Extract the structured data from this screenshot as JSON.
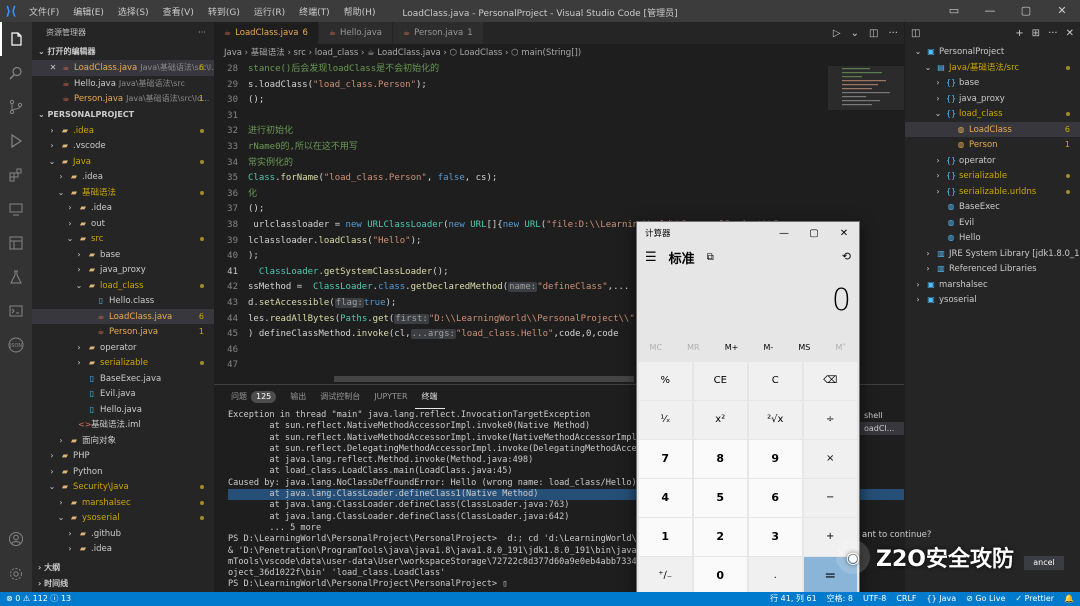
{
  "window": {
    "title": "LoadClass.java - PersonalProject - Visual Studio Code [管理员]",
    "menu": [
      "文件(F)",
      "编辑(E)",
      "选择(S)",
      "查看(V)",
      "转到(G)",
      "运行(R)",
      "终端(T)",
      "帮助(H)"
    ]
  },
  "sidebar": {
    "title": "资源管理器",
    "open_editors_header": "打开的编辑器",
    "open_editors": [
      {
        "name": "LoadClass.java",
        "desc": "Java\\基础语法\\src\\l...",
        "badge": "6"
      },
      {
        "name": "Hello.java",
        "desc": "Java\\基础语法\\src",
        "badge": ""
      },
      {
        "name": "Person.java",
        "desc": "Java\\基础语法\\src\\lo...",
        "badge": "1"
      }
    ],
    "project_header": "PERSONALPROJECT",
    "tree": [
      {
        "label": ".idea",
        "indent": 1,
        "type": "folder",
        "arrow": "›",
        "dot": true
      },
      {
        "label": ".vscode",
        "indent": 1,
        "type": "folder",
        "arrow": "›",
        "dot": false
      },
      {
        "label": "Java",
        "indent": 1,
        "type": "folder",
        "arrow": "⌄",
        "dot": true
      },
      {
        "label": ".idea",
        "indent": 2,
        "type": "folder",
        "arrow": "›",
        "dot": false
      },
      {
        "label": "基础语法",
        "indent": 2,
        "type": "folder",
        "arrow": "⌄",
        "dot": true
      },
      {
        "label": ".idea",
        "indent": 3,
        "type": "folder",
        "arrow": "›",
        "dot": false
      },
      {
        "label": "out",
        "indent": 3,
        "type": "folder",
        "arrow": "›",
        "dot": false
      },
      {
        "label": "src",
        "indent": 3,
        "type": "folder",
        "arrow": "⌄",
        "dot": true
      },
      {
        "label": "base",
        "indent": 4,
        "type": "folder",
        "arrow": "›",
        "dot": false
      },
      {
        "label": "java_proxy",
        "indent": 4,
        "type": "folder",
        "arrow": "›",
        "dot": false
      },
      {
        "label": "load_class",
        "indent": 4,
        "type": "folder",
        "arrow": "⌄",
        "dot": true
      },
      {
        "label": "Hello.class",
        "indent": 5,
        "type": "file",
        "arrow": "",
        "dot": false
      },
      {
        "label": "LoadClass.java",
        "indent": 5,
        "type": "java",
        "arrow": "",
        "badge": "6",
        "selected": true
      },
      {
        "label": "Person.java",
        "indent": 5,
        "type": "java",
        "arrow": "",
        "badge": "1"
      },
      {
        "label": "operator",
        "indent": 4,
        "type": "folder",
        "arrow": "›",
        "dot": false
      },
      {
        "label": "serializable",
        "indent": 4,
        "type": "folder",
        "arrow": "›",
        "dot": true
      },
      {
        "label": "BaseExec.java",
        "indent": 4,
        "type": "file",
        "arrow": "",
        "dot": false
      },
      {
        "label": "Evil.java",
        "indent": 4,
        "type": "file",
        "arrow": "",
        "dot": false
      },
      {
        "label": "Hello.java",
        "indent": 4,
        "type": "file",
        "arrow": "",
        "dot": false
      },
      {
        "label": "基础语法.iml",
        "indent": 3,
        "type": "xml",
        "arrow": "",
        "dot": false
      },
      {
        "label": "面向对象",
        "indent": 2,
        "type": "folder",
        "arrow": "›",
        "dot": false
      },
      {
        "label": "PHP",
        "indent": 1,
        "type": "folder",
        "arrow": "›",
        "dot": false
      },
      {
        "label": "Python",
        "indent": 1,
        "type": "folder",
        "arrow": "›",
        "dot": false
      },
      {
        "label": "Security\\Java",
        "indent": 1,
        "type": "folder",
        "arrow": "⌄",
        "dot": true
      },
      {
        "label": "marshalsec",
        "indent": 2,
        "type": "folder",
        "arrow": "›",
        "dot": true
      },
      {
        "label": "ysoserial",
        "indent": 2,
        "type": "folder",
        "arrow": "⌄",
        "dot": true
      },
      {
        "label": ".github",
        "indent": 3,
        "type": "folder",
        "arrow": "›",
        "dot": false
      },
      {
        "label": ".idea",
        "indent": 3,
        "type": "folder",
        "arrow": "›",
        "dot": false
      }
    ],
    "outline_header": "大纲",
    "timeline_header": "时间线"
  },
  "editor": {
    "tabs": [
      {
        "name": "LoadClass.java",
        "badge": "6",
        "active": true
      },
      {
        "name": "Hello.java",
        "badge": "",
        "active": false
      },
      {
        "name": "Person.java",
        "badge": "1",
        "active": false
      }
    ],
    "breadcrumb": "Java › 基础语法 › src › load_class › ☕ LoadClass.java › ⬡ LoadClass › ⬡ main(String[])",
    "lines": [
      {
        "n": "28",
        "html": "<span class='cmt'>stance()后会发现loadClass是不会初始化的</span>"
      },
      {
        "n": "29",
        "html": "s.loadClass(<span class='str'>\"load_class.Person\"</span>);"
      },
      {
        "n": "30",
        "html": "();"
      },
      {
        "n": "31",
        "html": ""
      },
      {
        "n": "32",
        "html": "<span class='cmt'>进行初始化</span>"
      },
      {
        "n": "33",
        "html": "<span class='cmt'>rName0的,所以在这不用写</span>"
      },
      {
        "n": "34",
        "html": "<span class='cmt'>常实例化的</span>"
      },
      {
        "n": "35",
        "html": "<span class='ty'>Class</span>.<span class='fn'>forName</span>(<span class='str'>\"load_class.Person\"</span>, <span class='kw'>false</span>, cs);"
      },
      {
        "n": "36",
        "html": "<span class='cmt'>化</span>"
      },
      {
        "n": "37",
        "html": "();"
      },
      {
        "n": "38",
        "html": " urlclassloader = <span class='kw'>new</span> <span class='ty'>URLClassLoader</span>(<span class='kw'>new</span> <span class='ty'>URL</span>[]{<span class='kw'>new</span> <span class='ty'>URL</span>(<span class='str'>\"file:D:\\\\LearningWorld\\\\PersonalProject\\\\Persona</span>"
      },
      {
        "n": "39",
        "html": "lclassloader.<span class='fn'>loadClass</span>(<span class='str'>\"Hello\"</span>);"
      },
      {
        "n": "40",
        "html": ");"
      },
      {
        "n": "41",
        "html": "  <span class='ty'>ClassLoader</span>.<span class='fn'>getSystemClassLoader</span>();",
        "cur": true
      },
      {
        "n": "42",
        "html": "ssMethod =  <span class='ty'>ClassLoader</span>.<span class='kw'>class</span>.<span class='fn'>getDeclaredMethod</span>(<span class='hint'>name:</span><span class='str'>\"defineClass\"</span>,..."
      },
      {
        "n": "43",
        "html": "d.<span class='fn'>setAccessible</span>(<span class='hint'>flag:</span><span class='kw'>true</span>);"
      },
      {
        "n": "44",
        "html": "les.<span class='fn'>readAllBytes</span>(<span class='ty'>Paths</span>.<span class='fn'>get</span>(<span class='hint'>first:</span><span class='str'>\"D:\\\\LearningWorld\\\\PersonalProject\\\\\"</span>"
      },
      {
        "n": "45",
        "html": ") defineClassMethod.<span class='fn'>invoke</span>(cl,<span class='hint'>...args:</span><span class='str'>\"load_class.Hello\"</span>,code,0,code"
      },
      {
        "n": "46",
        "html": ""
      },
      {
        "n": "47",
        "html": ""
      }
    ]
  },
  "panel": {
    "tabs": [
      "问题",
      "输出",
      "调试控制台",
      "JUPYTER",
      "终端"
    ],
    "problems_count": "125",
    "active_tab": "终端",
    "terminal_list": [
      "shell",
      "oadCl..."
    ],
    "terminal": [
      {
        "t": "Exception in thread \"main\" java.lang.reflect.InvocationTargetException"
      },
      {
        "t": "        at sun.reflect.NativeMethodAccessorImpl.invoke0(Native Method)"
      },
      {
        "t": "        at sun.reflect.NativeMethodAccessorImpl.invoke(NativeMethodAccessorImpl."
      },
      {
        "t": "        at sun.reflect.DelegatingMethodAccessorImpl.invoke(DelegatingMethodAccess"
      },
      {
        "t": "        at java.lang.reflect.Method.invoke(Method.java:498)"
      },
      {
        "t": "        at load_class.LoadClass.main(LoadClass.java:45)"
      },
      {
        "t": "Caused by: java.lang.NoClassDefFoundError: Hello (wrong name: load_class/Hello)"
      },
      {
        "t": "        at java.lang.ClassLoader.defineClass1(Native Method)",
        "hl": true
      },
      {
        "t": "        at java.lang.ClassLoader.defineClass(ClassLoader.java:763)"
      },
      {
        "t": "        at java.lang.ClassLoader.defineClass(ClassLoader.java:642)"
      },
      {
        "t": "        ... 5 more"
      },
      {
        "t": "PS D:\\LearningWorld\\PersonalProject\\PersonalProject>  d:; cd 'd:\\LearningWorld\\Pe"
      },
      {
        "t": "& 'D:\\Penetration\\ProgramTools\\java\\java1.8\\java1.8.0_191\\jdk1.8.0_191\\bin\\java."
      },
      {
        "t": "mTools\\vscode\\data\\user-data\\User\\workspaceStorage\\72722c8d377d60a9e0eb4abb7334f"
      },
      {
        "t": "oject_36d1022f\\bin' 'load_class.LoadClass'"
      },
      {
        "t": "PS D:\\LearningWorld\\PersonalProject\\PersonalProject> ▯"
      }
    ]
  },
  "rightpanel": {
    "items": [
      {
        "label": "PersonalProject",
        "indent": 0,
        "arrow": "⌄",
        "icon": "▣",
        "cls": ""
      },
      {
        "label": "Java/基础语法/src",
        "indent": 1,
        "arrow": "⌄",
        "icon": "▤",
        "cls": "warn"
      },
      {
        "label": "base",
        "indent": 2,
        "arrow": "›",
        "icon": "{}",
        "cls": ""
      },
      {
        "label": "java_proxy",
        "indent": 2,
        "arrow": "›",
        "icon": "{}",
        "cls": ""
      },
      {
        "label": "load_class",
        "indent": 2,
        "arrow": "⌄",
        "icon": "{}",
        "cls": "warn"
      },
      {
        "label": "LoadClass",
        "indent": 3,
        "arrow": "",
        "icon": "◍",
        "cls": "ora",
        "badge": "6",
        "selected": true
      },
      {
        "label": "Person",
        "indent": 3,
        "arrow": "",
        "icon": "◍",
        "cls": "ora",
        "badge": "1"
      },
      {
        "label": "operator",
        "indent": 2,
        "arrow": "›",
        "icon": "{}",
        "cls": ""
      },
      {
        "label": "serializable",
        "indent": 2,
        "arrow": "›",
        "icon": "{}",
        "cls": "warn"
      },
      {
        "label": "serializable.urldns",
        "indent": 2,
        "arrow": "›",
        "icon": "{}",
        "cls": "warn"
      },
      {
        "label": "BaseExec",
        "indent": 2,
        "arrow": "",
        "icon": "◍",
        "cls": ""
      },
      {
        "label": "Evil",
        "indent": 2,
        "arrow": "",
        "icon": "◍",
        "cls": ""
      },
      {
        "label": "Hello",
        "indent": 2,
        "arrow": "",
        "icon": "◍",
        "cls": ""
      },
      {
        "label": "JRE System Library [jdk1.8.0_1",
        "indent": 1,
        "arrow": "›",
        "icon": "▥",
        "cls": ""
      },
      {
        "label": "Referenced Libraries",
        "indent": 1,
        "arrow": "›",
        "icon": "▥",
        "cls": ""
      },
      {
        "label": "marshalsec",
        "indent": 0,
        "arrow": "›",
        "icon": "▣",
        "cls": ""
      },
      {
        "label": "ysoserial",
        "indent": 0,
        "arrow": "›",
        "icon": "▣",
        "cls": ""
      }
    ]
  },
  "calculator": {
    "title": "计算器",
    "mode": "标准",
    "display": "0",
    "memory": [
      {
        "label": "MC",
        "enabled": false
      },
      {
        "label": "MR",
        "enabled": false
      },
      {
        "label": "M+",
        "enabled": true
      },
      {
        "label": "M-",
        "enabled": true
      },
      {
        "label": "MS",
        "enabled": true
      },
      {
        "label": "M˅",
        "enabled": false
      }
    ],
    "keys": [
      {
        "label": "%",
        "kind": "op"
      },
      {
        "label": "CE",
        "kind": "op"
      },
      {
        "label": "C",
        "kind": "op"
      },
      {
        "label": "⌫",
        "kind": "op"
      },
      {
        "label": "¹⁄ₓ",
        "kind": "op"
      },
      {
        "label": "x²",
        "kind": "op"
      },
      {
        "label": "²√x",
        "kind": "op"
      },
      {
        "label": "÷",
        "kind": "op"
      },
      {
        "label": "7",
        "kind": "num"
      },
      {
        "label": "8",
        "kind": "num"
      },
      {
        "label": "9",
        "kind": "num"
      },
      {
        "label": "×",
        "kind": "op"
      },
      {
        "label": "4",
        "kind": "num"
      },
      {
        "label": "5",
        "kind": "num"
      },
      {
        "label": "6",
        "kind": "num"
      },
      {
        "label": "−",
        "kind": "op"
      },
      {
        "label": "1",
        "kind": "num"
      },
      {
        "label": "2",
        "kind": "num"
      },
      {
        "label": "3",
        "kind": "num"
      },
      {
        "label": "+",
        "kind": "op"
      },
      {
        "label": "⁺∕₋",
        "kind": "op"
      },
      {
        "label": "0",
        "kind": "num"
      },
      {
        "label": ".",
        "kind": "op"
      },
      {
        "label": "=",
        "kind": "eq"
      }
    ]
  },
  "overlay": {
    "continue_text": "ant to continue?",
    "cancel_label": "ancel",
    "watermark": "Z2O安全攻防"
  },
  "status": {
    "left": "⊗ 0 ⚠ 112 ⓘ 13",
    "right": [
      "行 41, 列 61",
      "空格: 8",
      "UTF-8",
      "CRLF",
      "{} Java",
      "⊘ Go Live",
      "✓ Prettier",
      "🔔"
    ]
  },
  "colors": {
    "accent": "#007acc",
    "warning": "#cca700",
    "java_file": "#e76f51"
  }
}
